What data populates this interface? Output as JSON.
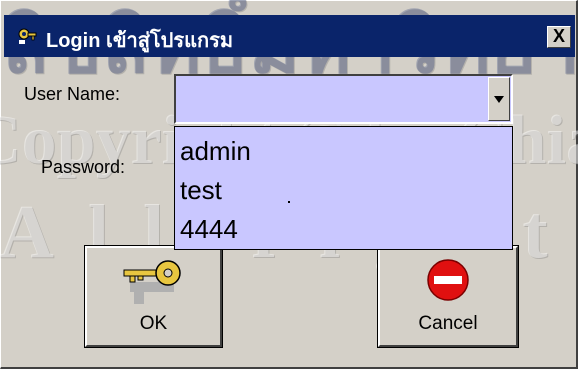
{
  "window": {
    "title": "Login เข้าสู่โปรแกรม",
    "close_label": "X",
    "title_bar_color": "#0a246a",
    "face_color": "#d4d0c8",
    "field_color": "#c9c7ff"
  },
  "form": {
    "username_label": "User Name:",
    "username_value": "",
    "password_label": "Password:",
    "password_value": ""
  },
  "dropdown": {
    "options": [
      "admin",
      "test",
      "4444"
    ]
  },
  "buttons": {
    "ok_label": "OK",
    "cancel_label": "Cancel"
  },
  "watermark": {
    "line1": "ลิขสิทธิ์มหาวิทยาลัยเชียงใหม่",
    "line2": "Copyright © by Chiang Mai University",
    "line3": "All rights reserved"
  },
  "icons": {
    "title": "app-key-icon",
    "ok": "key-icon",
    "cancel": "no-entry-icon"
  }
}
